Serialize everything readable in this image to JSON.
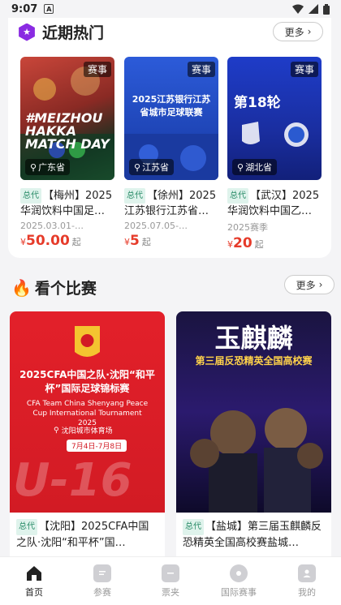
{
  "status": {
    "time": "9:07",
    "notif": "A"
  },
  "hot": {
    "title": "近期热门",
    "more": "更多",
    "events": [
      {
        "tag": "赛事",
        "loc": "广东省",
        "badge": "总代",
        "title": "【梅州】2025华润饮料中国足…",
        "date": "2025.03.01-…",
        "price": "50.00",
        "img_text": "#MEIZHOU HAKKA MATCH DAY"
      },
      {
        "tag": "赛事",
        "loc": "江苏省",
        "badge": "总代",
        "title": "【徐州】2025江苏银行江苏省…",
        "date": "2025.07.05-…",
        "price": "5",
        "img_text": "2025江苏银行江苏省城市足球联赛"
      },
      {
        "tag": "赛事",
        "loc": "湖北省",
        "badge": "总代",
        "title": "【武汉】2025华润饮料中国乙…",
        "date": "2025赛季",
        "price": "20",
        "img_text": "第18轮"
      }
    ],
    "currency": "¥",
    "price_unit": "起"
  },
  "matches": {
    "title": "看个比赛",
    "more": "更多",
    "items": [
      {
        "badge": "总代",
        "title": "【沈阳】2025CFA中国之队·沈阳“和平杯”国…",
        "poster_title": "2025CFA中国之队·沈阳“和平杯”国际足球锦标赛",
        "poster_sub": "CFA Team China Shenyang Peace Cup International Tournament 2025",
        "venue": "沈阳城市体育场",
        "dates": "7月4日-7月8日",
        "big": "U-16"
      },
      {
        "badge": "总代",
        "title": "【盐城】第三届玉麒麟反恐精英全国高校赛盐城…",
        "poster_title": "玉麒麟",
        "poster_sub": "第三届反恐精英全国高校赛"
      }
    ]
  },
  "nav": [
    {
      "label": "首页",
      "icon": "home-icon",
      "active": true
    },
    {
      "label": "参赛",
      "icon": "entry-icon",
      "active": false
    },
    {
      "label": "票夹",
      "icon": "ticket-folder-icon",
      "active": false
    },
    {
      "label": "国际赛事",
      "icon": "globe-icon",
      "active": false
    },
    {
      "label": "我的",
      "icon": "profile-icon",
      "active": false
    }
  ]
}
